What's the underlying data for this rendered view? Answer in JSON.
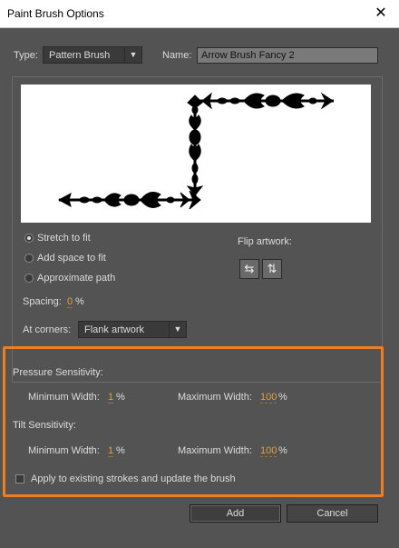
{
  "window": {
    "title": "Paint Brush Options",
    "close_glyph": "✕"
  },
  "type": {
    "label": "Type:",
    "value": "Pattern Brush"
  },
  "name": {
    "label": "Name:",
    "value": "Arrow Brush Fancy 2"
  },
  "fit": {
    "options": [
      "Stretch to fit",
      "Add space to fit",
      "Approximate path"
    ],
    "selected": "Stretch to fit"
  },
  "flip": {
    "label": "Flip artwork:"
  },
  "spacing": {
    "label": "Spacing:",
    "value": "0",
    "unit": "%"
  },
  "corners": {
    "label": "At corners:",
    "value": "Flank artwork"
  },
  "pressure": {
    "heading": "Pressure Sensitivity:",
    "min_label": "Minimum Width:",
    "min_value": "1",
    "min_unit": "%",
    "max_label": "Maximum Width:",
    "max_value": "100",
    "max_unit": "%"
  },
  "tilt": {
    "heading": "Tilt Sensitivity:",
    "min_label": "Minimum Width:",
    "min_value": "1",
    "min_unit": "%",
    "max_label": "Maximum Width:",
    "max_value": "100",
    "max_unit": "%"
  },
  "apply": {
    "label": "Apply to existing strokes and update the brush",
    "checked": false
  },
  "buttons": {
    "add": "Add",
    "cancel": "Cancel"
  },
  "colors": {
    "accent_highlight": "#f07d1f",
    "value_text": "#e0a040",
    "dialog_bg": "#535353"
  },
  "icons": {
    "flip_horizontal": "flip-horizontal-icon",
    "flip_vertical": "flip-vertical-icon",
    "dropdown": "chevron-down-icon"
  }
}
